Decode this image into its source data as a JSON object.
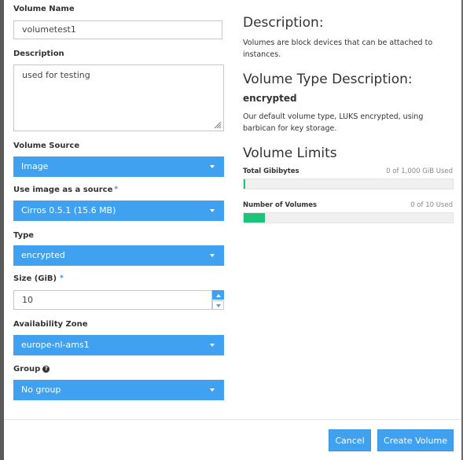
{
  "form": {
    "volume_name": {
      "label": "Volume Name",
      "value": "volumetest1"
    },
    "description": {
      "label": "Description",
      "value": "used for testing"
    },
    "volume_source": {
      "label": "Volume Source",
      "value": "Image"
    },
    "image_source": {
      "label": "Use image as a source",
      "required": "*",
      "value": "Cirros 0.5.1 (15.6 MB)"
    },
    "type": {
      "label": "Type",
      "value": "encrypted"
    },
    "size": {
      "label": "Size (GiB)",
      "required": "*",
      "value": "10"
    },
    "availability_zone": {
      "label": "Availability Zone",
      "value": "europe-nl-ams1"
    },
    "group": {
      "label": "Group",
      "help_icon": "?",
      "value": "No group"
    }
  },
  "info": {
    "description_title": "Description:",
    "description_text": "Volumes are block devices that can be attached to instances.",
    "type_title": "Volume Type Description:",
    "type_name": "encrypted",
    "type_text": "Our default volume type, LUKS encrypted, using barbican for key storage.",
    "limits_title": "Volume Limits",
    "limits": [
      {
        "label": "Total Gibibytes",
        "used_text": "0 of 1,000 GiB Used",
        "fill_fraction": 0.003
      },
      {
        "label": "Number of Volumes",
        "used_text": "0 of 10 Used",
        "fill_fraction": 0.1
      }
    ]
  },
  "footer": {
    "cancel_label": "Cancel",
    "create_label": "Create Volume"
  },
  "colors": {
    "accent": "#3fa1f0",
    "progress": "#1ec37b"
  }
}
